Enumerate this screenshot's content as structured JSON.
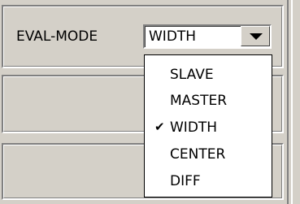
{
  "eval_mode": {
    "label": "EVAL-MODE",
    "selected": "WIDTH"
  },
  "dropdown": {
    "options": [
      {
        "label": "SLAVE",
        "checked": false
      },
      {
        "label": "MASTER",
        "checked": false
      },
      {
        "label": "WIDTH",
        "checked": true
      },
      {
        "label": "CENTER",
        "checked": false
      },
      {
        "label": "DIFF",
        "checked": false
      }
    ],
    "check_mark": "✔"
  },
  "icons": {
    "combo_arrow": "chevron-down-icon",
    "check": "checkmark-icon"
  }
}
